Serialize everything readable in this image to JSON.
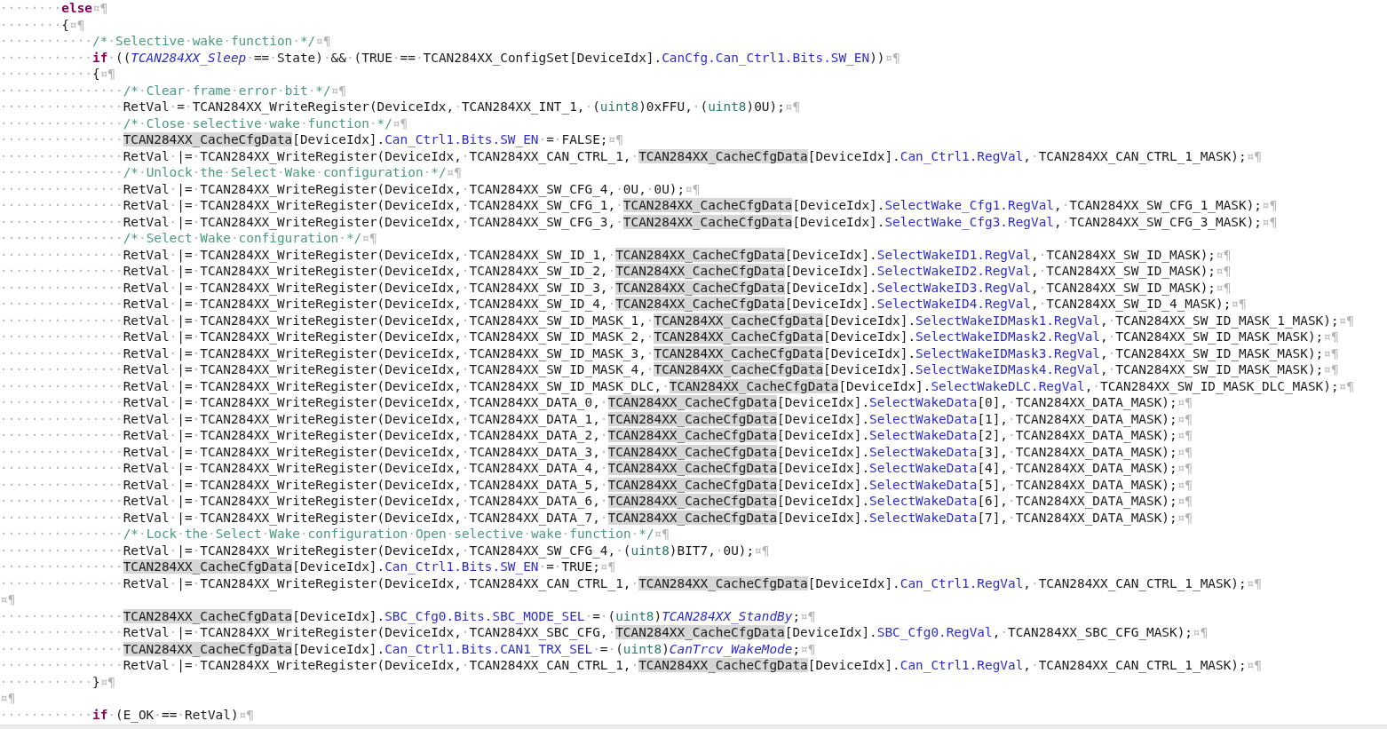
{
  "editor": {
    "lines": [
      {
        "parts": [
          "········",
          {
            "kind": "keyword",
            "text": "else"
          },
          "¤¶"
        ]
      },
      {
        "parts": [
          "········{¤¶"
        ]
      },
      {
        "parts": [
          "············",
          {
            "kind": "comment",
            "text": "/*·Selective·wake·function·*/"
          },
          "¤¶"
        ]
      },
      {
        "parts": [
          "············",
          {
            "kind": "keyword",
            "text": "if"
          },
          "·((",
          {
            "kind": "enum",
            "text": "TCAN284XX_Sleep"
          },
          "·==·State)·&&·(TRUE·==·TCAN284XX_ConfigSet[DeviceIdx].",
          {
            "kind": "member",
            "text": "CanCfg.Can_Ctrl1.Bits.SW_EN"
          },
          "))¤¶"
        ]
      },
      {
        "parts": [
          "············{¤¶"
        ]
      },
      {
        "parts": [
          "················",
          {
            "kind": "comment",
            "text": "/*·Clear·frame·error·bit·*/"
          },
          "¤¶"
        ]
      },
      {
        "parts": [
          "················RetVal·=·TCAN284XX_WriteRegister(DeviceIdx,·TCAN284XX_INT_1,·(",
          {
            "kind": "type",
            "text": "uint8"
          },
          ")0xFFU,·(",
          {
            "kind": "type",
            "text": "uint8"
          },
          ")0U);¤¶"
        ]
      },
      {
        "parts": [
          "················",
          {
            "kind": "comment",
            "text": "/*·Close·selective·wake·function·*/"
          },
          "¤¶"
        ]
      },
      {
        "parts": [
          "················",
          {
            "kind": "highlight",
            "text": "TCAN284XX_CacheCfgData"
          },
          "[DeviceIdx].",
          {
            "kind": "member",
            "text": "Can_Ctrl1.Bits.SW_EN"
          },
          "·=·FALSE;¤¶"
        ]
      },
      {
        "parts": [
          "················RetVal·|=·TCAN284XX_WriteRegister(DeviceIdx,·TCAN284XX_CAN_CTRL_1,·",
          {
            "kind": "highlight",
            "text": "TCAN284XX_CacheCfgData"
          },
          "[DeviceIdx].",
          {
            "kind": "member",
            "text": "Can_Ctrl1.RegVal"
          },
          ",·TCAN284XX_CAN_CTRL_1_MASK);¤¶"
        ]
      },
      {
        "parts": [
          "················",
          {
            "kind": "comment",
            "text": "/*·Unlock·the·Select·Wake·configuration·*/"
          },
          "¤¶"
        ]
      },
      {
        "parts": [
          "················RetVal·|=·TCAN284XX_WriteRegister(DeviceIdx,·TCAN284XX_SW_CFG_4,·0U,·0U);¤¶"
        ]
      },
      {
        "parts": [
          "················RetVal·|=·TCAN284XX_WriteRegister(DeviceIdx,·TCAN284XX_SW_CFG_1,·",
          {
            "kind": "highlight",
            "text": "TCAN284XX_CacheCfgData"
          },
          "[DeviceIdx].",
          {
            "kind": "member",
            "text": "SelectWake_Cfg1.RegVal"
          },
          ",·TCAN284XX_SW_CFG_1_MASK);¤¶"
        ]
      },
      {
        "parts": [
          "················RetVal·|=·TCAN284XX_WriteRegister(DeviceIdx,·TCAN284XX_SW_CFG_3,·",
          {
            "kind": "highlight",
            "text": "TCAN284XX_CacheCfgData"
          },
          "[DeviceIdx].",
          {
            "kind": "member",
            "text": "SelectWake_Cfg3.RegVal"
          },
          ",·TCAN284XX_SW_CFG_3_MASK);¤¶"
        ]
      },
      {
        "parts": [
          "················",
          {
            "kind": "comment",
            "text": "/*·Select·Wake·configuration·*/"
          },
          "¤¶"
        ]
      },
      {
        "parts": [
          "················RetVal·|=·TCAN284XX_WriteRegister(DeviceIdx,·TCAN284XX_SW_ID_1,·",
          {
            "kind": "highlight",
            "text": "TCAN284XX_CacheCfgData"
          },
          "[DeviceIdx].",
          {
            "kind": "member",
            "text": "SelectWakeID1.RegVal"
          },
          ",·TCAN284XX_SW_ID_MASK);¤¶"
        ]
      },
      {
        "parts": [
          "················RetVal·|=·TCAN284XX_WriteRegister(DeviceIdx,·TCAN284XX_SW_ID_2,·",
          {
            "kind": "highlight",
            "text": "TCAN284XX_CacheCfgData"
          },
          "[DeviceIdx].",
          {
            "kind": "member",
            "text": "SelectWakeID2.RegVal"
          },
          ",·TCAN284XX_SW_ID_MASK);¤¶"
        ]
      },
      {
        "parts": [
          "················RetVal·|=·TCAN284XX_WriteRegister(DeviceIdx,·TCAN284XX_SW_ID_3,·",
          {
            "kind": "highlight",
            "text": "TCAN284XX_CacheCfgData"
          },
          "[DeviceIdx].",
          {
            "kind": "member",
            "text": "SelectWakeID3.RegVal"
          },
          ",·TCAN284XX_SW_ID_MASK);¤¶"
        ]
      },
      {
        "parts": [
          "················RetVal·|=·TCAN284XX_WriteRegister(DeviceIdx,·TCAN284XX_SW_ID_4,·",
          {
            "kind": "highlight",
            "text": "TCAN284XX_CacheCfgData"
          },
          "[DeviceIdx].",
          {
            "kind": "member",
            "text": "SelectWakeID4.RegVal"
          },
          ",·TCAN284XX_SW_ID_4_MASK);¤¶"
        ]
      },
      {
        "parts": [
          "················RetVal·|=·TCAN284XX_WriteRegister(DeviceIdx,·TCAN284XX_SW_ID_MASK_1,·",
          {
            "kind": "highlight",
            "text": "TCAN284XX_CacheCfgData"
          },
          "[DeviceIdx].",
          {
            "kind": "member",
            "text": "SelectWakeIDMask1.RegVal"
          },
          ",·TCAN284XX_SW_ID_MASK_1_MASK);¤¶"
        ]
      },
      {
        "parts": [
          "················RetVal·|=·TCAN284XX_WriteRegister(DeviceIdx,·TCAN284XX_SW_ID_MASK_2,·",
          {
            "kind": "highlight",
            "text": "TCAN284XX_CacheCfgData"
          },
          "[DeviceIdx].",
          {
            "kind": "member",
            "text": "SelectWakeIDMask2.RegVal"
          },
          ",·TCAN284XX_SW_ID_MASK_MASK);¤¶"
        ]
      },
      {
        "parts": [
          "················RetVal·|=·TCAN284XX_WriteRegister(DeviceIdx,·TCAN284XX_SW_ID_MASK_3,·",
          {
            "kind": "highlight",
            "text": "TCAN284XX_CacheCfgData"
          },
          "[DeviceIdx].",
          {
            "kind": "member",
            "text": "SelectWakeIDMask3.RegVal"
          },
          ",·TCAN284XX_SW_ID_MASK_MASK);¤¶"
        ]
      },
      {
        "parts": [
          "················RetVal·|=·TCAN284XX_WriteRegister(DeviceIdx,·TCAN284XX_SW_ID_MASK_4,·",
          {
            "kind": "highlight",
            "text": "TCAN284XX_CacheCfgData"
          },
          "[DeviceIdx].",
          {
            "kind": "member",
            "text": "SelectWakeIDMask4.RegVal"
          },
          ",·TCAN284XX_SW_ID_MASK_MASK);¤¶"
        ]
      },
      {
        "parts": [
          "················RetVal·|=·TCAN284XX_WriteRegister(DeviceIdx,·TCAN284XX_SW_ID_MASK_DLC,·",
          {
            "kind": "highlight",
            "text": "TCAN284XX_CacheCfgData"
          },
          "[DeviceIdx].",
          {
            "kind": "member",
            "text": "SelectWakeDLC.RegVal"
          },
          ",·TCAN284XX_SW_ID_MASK_DLC_MASK);¤¶"
        ]
      },
      {
        "parts": [
          "················RetVal·|=·TCAN284XX_WriteRegister(DeviceIdx,·TCAN284XX_DATA_0,·",
          {
            "kind": "highlight",
            "text": "TCAN284XX_CacheCfgData"
          },
          "[DeviceIdx].",
          {
            "kind": "member",
            "text": "SelectWakeData"
          },
          "[0],·TCAN284XX_DATA_MASK);¤¶"
        ]
      },
      {
        "parts": [
          "················RetVal·|=·TCAN284XX_WriteRegister(DeviceIdx,·TCAN284XX_DATA_1,·",
          {
            "kind": "highlight",
            "text": "TCAN284XX_CacheCfgData"
          },
          "[DeviceIdx].",
          {
            "kind": "member",
            "text": "SelectWakeData"
          },
          "[1],·TCAN284XX_DATA_MASK);¤¶"
        ]
      },
      {
        "parts": [
          "················RetVal·|=·TCAN284XX_WriteRegister(DeviceIdx,·TCAN284XX_DATA_2,·",
          {
            "kind": "highlight",
            "text": "TCAN284XX_CacheCfgData"
          },
          "[DeviceIdx].",
          {
            "kind": "member",
            "text": "SelectWakeData"
          },
          "[2],·TCAN284XX_DATA_MASK);¤¶"
        ]
      },
      {
        "parts": [
          "················RetVal·|=·TCAN284XX_WriteRegister(DeviceIdx,·TCAN284XX_DATA_3,·",
          {
            "kind": "highlight",
            "text": "TCAN284XX_CacheCfgData"
          },
          "[DeviceIdx].",
          {
            "kind": "member",
            "text": "SelectWakeData"
          },
          "[3],·TCAN284XX_DATA_MASK);¤¶"
        ]
      },
      {
        "parts": [
          "················RetVal·|=·TCAN284XX_WriteRegister(DeviceIdx,·TCAN284XX_DATA_4,·",
          {
            "kind": "highlight",
            "text": "TCAN284XX_CacheCfgData"
          },
          "[DeviceIdx].",
          {
            "kind": "member",
            "text": "SelectWakeData"
          },
          "[4],·TCAN284XX_DATA_MASK);¤¶"
        ]
      },
      {
        "parts": [
          "················RetVal·|=·TCAN284XX_WriteRegister(DeviceIdx,·TCAN284XX_DATA_5,·",
          {
            "kind": "highlight",
            "text": "TCAN284XX_CacheCfgData"
          },
          "[DeviceIdx].",
          {
            "kind": "member",
            "text": "SelectWakeData"
          },
          "[5],·TCAN284XX_DATA_MASK);¤¶"
        ]
      },
      {
        "parts": [
          "················RetVal·|=·TCAN284XX_WriteRegister(DeviceIdx,·TCAN284XX_DATA_6,·",
          {
            "kind": "highlight",
            "text": "TCAN284XX_CacheCfgData"
          },
          "[DeviceIdx].",
          {
            "kind": "member",
            "text": "SelectWakeData"
          },
          "[6],·TCAN284XX_DATA_MASK);¤¶"
        ]
      },
      {
        "parts": [
          "················RetVal·|=·TCAN284XX_WriteRegister(DeviceIdx,·TCAN284XX_DATA_7,·",
          {
            "kind": "highlight",
            "text": "TCAN284XX_CacheCfgData"
          },
          "[DeviceIdx].",
          {
            "kind": "member",
            "text": "SelectWakeData"
          },
          "[7],·TCAN284XX_DATA_MASK);¤¶"
        ]
      },
      {
        "parts": [
          "················",
          {
            "kind": "comment",
            "text": "/*·Lock·the·Select·Wake·configuration·Open·selective·wake·function·*/"
          },
          "¤¶"
        ]
      },
      {
        "parts": [
          "················RetVal·|=·TCAN284XX_WriteRegister(DeviceIdx,·TCAN284XX_SW_CFG_4,·(",
          {
            "kind": "type",
            "text": "uint8"
          },
          ")BIT7,·0U);¤¶"
        ]
      },
      {
        "parts": [
          "················",
          {
            "kind": "highlight",
            "text": "TCAN284XX_CacheCfgData"
          },
          "[DeviceIdx].",
          {
            "kind": "member",
            "text": "Can_Ctrl1.Bits.SW_EN"
          },
          "·=·TRUE;¤¶"
        ]
      },
      {
        "parts": [
          "················RetVal·|=·TCAN284XX_WriteRegister(DeviceIdx,·TCAN284XX_CAN_CTRL_1,·",
          {
            "kind": "highlight",
            "text": "TCAN284XX_CacheCfgData"
          },
          "[DeviceIdx].",
          {
            "kind": "member",
            "text": "Can_Ctrl1.RegVal"
          },
          ",·TCAN284XX_CAN_CTRL_1_MASK);¤¶"
        ]
      },
      {
        "parts": [
          "¤¶"
        ]
      },
      {
        "parts": [
          "················",
          {
            "kind": "highlight",
            "text": "TCAN284XX_CacheCfgData"
          },
          "[DeviceIdx].",
          {
            "kind": "member",
            "text": "SBC_Cfg0.Bits.SBC_MODE_SEL"
          },
          "·=·(",
          {
            "kind": "type",
            "text": "uint8"
          },
          ")",
          {
            "kind": "enum",
            "text": "TCAN284XX_StandBy"
          },
          ";¤¶"
        ]
      },
      {
        "parts": [
          "················RetVal·|=·TCAN284XX_WriteRegister(DeviceIdx,·TCAN284XX_SBC_CFG,·",
          {
            "kind": "highlight",
            "text": "TCAN284XX_CacheCfgData"
          },
          "[DeviceIdx].",
          {
            "kind": "member",
            "text": "SBC_Cfg0.RegVal"
          },
          ",·TCAN284XX_SBC_CFG_MASK);¤¶"
        ]
      },
      {
        "parts": [
          "················",
          {
            "kind": "highlight",
            "text": "TCAN284XX_CacheCfgData"
          },
          "[DeviceIdx].",
          {
            "kind": "member",
            "text": "Can_Ctrl1.Bits.CAN1_TRX_SEL"
          },
          "·=·(",
          {
            "kind": "type",
            "text": "uint8"
          },
          ")",
          {
            "kind": "enum",
            "text": "CanTrcv_WakeMode"
          },
          ";¤¶"
        ]
      },
      {
        "parts": [
          "················RetVal·|=·TCAN284XX_WriteRegister(DeviceIdx,·TCAN284XX_CAN_CTRL_1,·",
          {
            "kind": "highlight",
            "text": "TCAN284XX_CacheCfgData"
          },
          "[DeviceIdx].",
          {
            "kind": "member",
            "text": "Can_Ctrl1.RegVal"
          },
          ",·TCAN284XX_CAN_CTRL_1_MASK);¤¶"
        ]
      },
      {
        "parts": [
          "············}¤¶"
        ]
      },
      {
        "parts": [
          "¤¶"
        ]
      },
      {
        "parts": [
          "············",
          {
            "kind": "keyword",
            "text": "if"
          },
          "·(E_OK·==·RetVal)¤¶"
        ]
      }
    ]
  }
}
